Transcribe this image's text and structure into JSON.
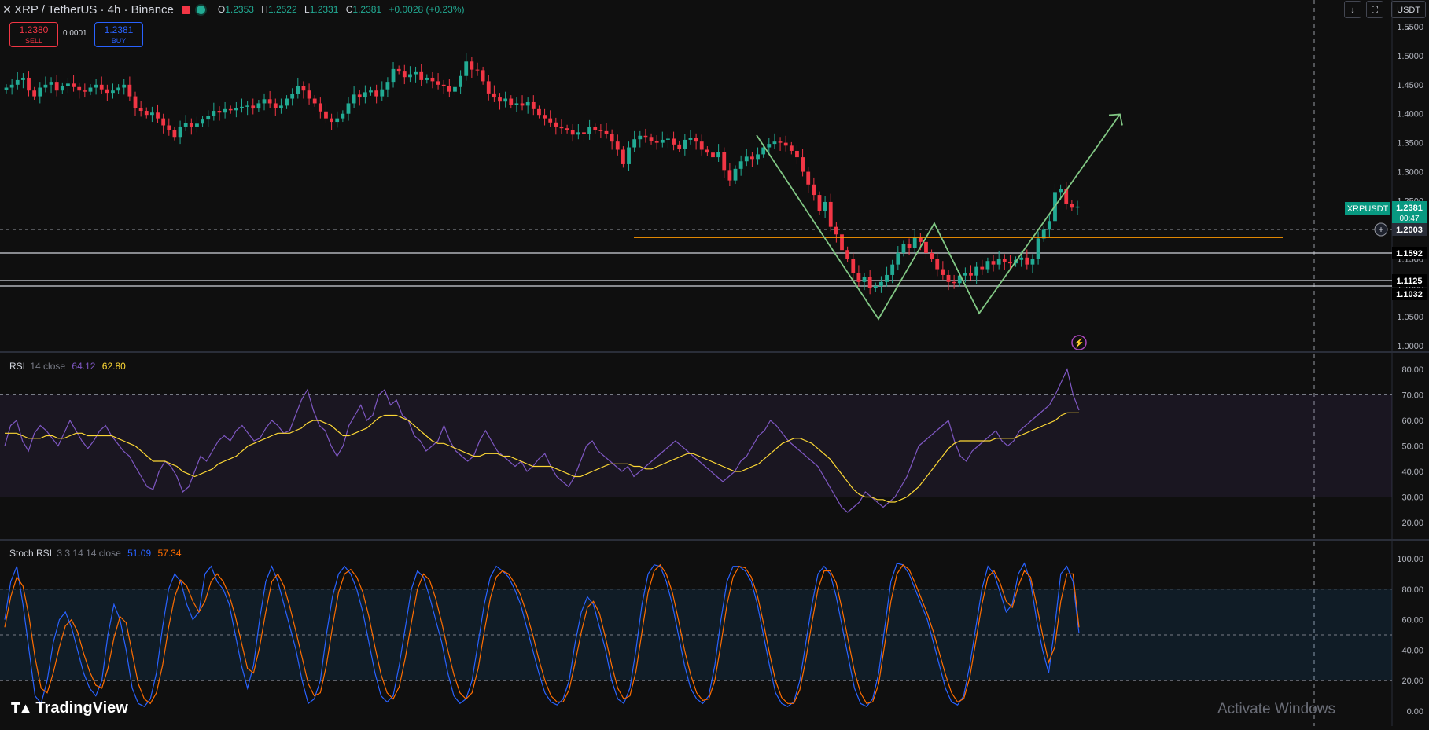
{
  "header": {
    "symbol": "XRP / TetherUS · 4h · Binance",
    "ohlc": {
      "o_label": "O",
      "o": "1.2353",
      "h_label": "H",
      "h": "1.2522",
      "l_label": "L",
      "l": "1.2331",
      "c_label": "C",
      "c": "1.2381",
      "change": "+0.0028 (+0.23%)"
    }
  },
  "trade": {
    "sell_price": "1.2380",
    "sell_label": "SELL",
    "spread": "0.0001",
    "buy_price": "1.2381",
    "buy_label": "BUY"
  },
  "controls": {
    "currency": "USDT"
  },
  "price_panel": {
    "axis_ticks": [
      "1.5500",
      "1.5000",
      "1.4500",
      "1.4000",
      "1.3500",
      "1.3000",
      "1.2500",
      "1.2000",
      "1.1500",
      "1.1000",
      "1.0500",
      "1.0000"
    ],
    "symbol_tag": "XRPUSDT",
    "last_price": "1.2381",
    "countdown": "00:47",
    "crosshair_price": "1.2003",
    "level_labels": [
      "1.1592",
      "1.1125",
      "1.1032"
    ]
  },
  "rsi_panel": {
    "name": "RSI",
    "params": "14 close",
    "value1": "64.12",
    "value2": "62.80",
    "axis_ticks": [
      "80.00",
      "70.00",
      "60.00",
      "50.00",
      "40.00",
      "30.00",
      "20.00"
    ]
  },
  "stoch_panel": {
    "name": "Stoch RSI",
    "params": "3 3 14 14 close",
    "value1": "51.09",
    "value2": "57.34",
    "axis_ticks": [
      "100.00",
      "80.00",
      "60.00",
      "40.00",
      "20.00",
      "0.00"
    ]
  },
  "branding": {
    "logo": "TradingView",
    "watermark": "Activate Windows"
  },
  "colors": {
    "up": "#22ab94",
    "down": "#f23645",
    "rsi": "#7e57c2",
    "rsi_ma": "#fdd835",
    "k": "#2962ff",
    "d": "#ff6d00",
    "pattern": "#81c784",
    "support": "#ff9800"
  },
  "chart_data": [
    {
      "type": "candlestick",
      "title": "XRP / TetherUS · 4h · Binance",
      "ylim": [
        0.985,
        1.56
      ],
      "series": [
        {
          "name": "XRPUSDT",
          "close": [
            1.445,
            1.45,
            1.458,
            1.462,
            1.44,
            1.43,
            1.445,
            1.45,
            1.455,
            1.44,
            1.448,
            1.452,
            1.446,
            1.44,
            1.438,
            1.445,
            1.45,
            1.442,
            1.436,
            1.44,
            1.445,
            1.45,
            1.43,
            1.41,
            1.405,
            1.398,
            1.402,
            1.392,
            1.38,
            1.372,
            1.36,
            1.378,
            1.384,
            1.378,
            1.383,
            1.39,
            1.396,
            1.405,
            1.402,
            1.408,
            1.406,
            1.41,
            1.412,
            1.414,
            1.409,
            1.418,
            1.425,
            1.418,
            1.41,
            1.414,
            1.426,
            1.434,
            1.448,
            1.44,
            1.426,
            1.418,
            1.404,
            1.392,
            1.386,
            1.392,
            1.4,
            1.418,
            1.433,
            1.428,
            1.437,
            1.44,
            1.43,
            1.442,
            1.455,
            1.477,
            1.474,
            1.463,
            1.468,
            1.473,
            1.458,
            1.462,
            1.456,
            1.45,
            1.448,
            1.438,
            1.446,
            1.465,
            1.49,
            1.476,
            1.475,
            1.456,
            1.435,
            1.428,
            1.421,
            1.426,
            1.415,
            1.418,
            1.414,
            1.42,
            1.408,
            1.398,
            1.392,
            1.385,
            1.378,
            1.375,
            1.372,
            1.364,
            1.368,
            1.365,
            1.377,
            1.372,
            1.37,
            1.365,
            1.352,
            1.338,
            1.313,
            1.342,
            1.356,
            1.362,
            1.36,
            1.353,
            1.35,
            1.355,
            1.357,
            1.347,
            1.34,
            1.355,
            1.358,
            1.352,
            1.338,
            1.333,
            1.325,
            1.334,
            1.303,
            1.285,
            1.305,
            1.318,
            1.326,
            1.322,
            1.33,
            1.342,
            1.348,
            1.352,
            1.35,
            1.345,
            1.336,
            1.325,
            1.3,
            1.278,
            1.26,
            1.232,
            1.248,
            1.205,
            1.192,
            1.165,
            1.15,
            1.125,
            1.11,
            1.118,
            1.099,
            1.103,
            1.11,
            1.122,
            1.14,
            1.16,
            1.175,
            1.168,
            1.186,
            1.179,
            1.16,
            1.15,
            1.132,
            1.122,
            1.11,
            1.108,
            1.121,
            1.125,
            1.121,
            1.136,
            1.132,
            1.146,
            1.14,
            1.15,
            1.145,
            1.142,
            1.148,
            1.152,
            1.14,
            1.15,
            1.185,
            1.2,
            1.215,
            1.265,
            1.27,
            1.245,
            1.238,
            1.24
          ]
        }
      ],
      "patterns": {
        "w_pattern": [
          [
            1.363,
            1.228
          ],
          [
            1.046,
            1.238
          ],
          [
            1.211,
            1.228
          ],
          [
            1.056,
            1.368
          ],
          [
            1.399,
            1.422
          ]
        ],
        "support_level": 1.187
      }
    },
    {
      "type": "line",
      "title": "RSI 14 close",
      "ylim": [
        15,
        83
      ],
      "bands": [
        70,
        50,
        30
      ],
      "series": [
        {
          "name": "RSI",
          "last": 64.12,
          "values": [
            50,
            58,
            60,
            52,
            48,
            55,
            58,
            56,
            53,
            50,
            55,
            60,
            56,
            52,
            49,
            52,
            56,
            58,
            54,
            51,
            48,
            46,
            42,
            38,
            34,
            33,
            40,
            44,
            42,
            38,
            32,
            34,
            40,
            46,
            44,
            48,
            52,
            54,
            52,
            56,
            58,
            55,
            52,
            53,
            57,
            60,
            58,
            55,
            56,
            62,
            68,
            72,
            64,
            58,
            56,
            50,
            46,
            50,
            58,
            62,
            66,
            60,
            62,
            70,
            72,
            66,
            68,
            62,
            60,
            54,
            52,
            48,
            50,
            52,
            58,
            52,
            48,
            46,
            44,
            46,
            52,
            56,
            52,
            48,
            46,
            44,
            42,
            44,
            40,
            42,
            45,
            47,
            42,
            38,
            36,
            34,
            38,
            44,
            50,
            52,
            48,
            46,
            44,
            42,
            40,
            42,
            38,
            40,
            42,
            44,
            46,
            48,
            50,
            52,
            50,
            48,
            46,
            44,
            42,
            40,
            38,
            36,
            38,
            40,
            44,
            46,
            50,
            54,
            56,
            60,
            58,
            55,
            52,
            50,
            48,
            46,
            44,
            42,
            38,
            34,
            30,
            26,
            24,
            26,
            28,
            32,
            30,
            28,
            26,
            28,
            30,
            34,
            38,
            44,
            50,
            52,
            54,
            56,
            58,
            60,
            52,
            46,
            44,
            48,
            50,
            52,
            54,
            56,
            52,
            50,
            52,
            56,
            58,
            60,
            62,
            64,
            66,
            70,
            75,
            80,
            70,
            64
          ]
        },
        {
          "name": "RSI-based MA",
          "last": 62.8,
          "values": [
            55,
            55,
            55,
            54,
            53,
            53,
            53,
            54,
            54,
            53,
            53,
            54,
            55,
            55,
            54,
            54,
            54,
            54,
            54,
            53,
            52,
            51,
            50,
            48,
            46,
            44,
            44,
            44,
            43,
            42,
            40,
            39,
            38,
            39,
            40,
            41,
            43,
            44,
            45,
            46,
            48,
            50,
            51,
            52,
            53,
            54,
            55,
            55,
            55,
            56,
            57,
            59,
            60,
            60,
            59,
            58,
            56,
            54,
            54,
            55,
            56,
            57,
            59,
            61,
            62,
            62,
            62,
            61,
            60,
            58,
            56,
            54,
            52,
            51,
            51,
            50,
            49,
            48,
            47,
            46,
            46,
            47,
            47,
            47,
            46,
            46,
            45,
            44,
            43,
            42,
            42,
            42,
            42,
            41,
            40,
            39,
            38,
            38,
            39,
            40,
            41,
            42,
            43,
            43,
            43,
            43,
            42,
            42,
            41,
            41,
            42,
            43,
            44,
            45,
            46,
            47,
            47,
            46,
            45,
            44,
            43,
            42,
            41,
            40,
            40,
            41,
            42,
            43,
            45,
            47,
            49,
            51,
            52,
            53,
            53,
            52,
            51,
            49,
            47,
            45,
            42,
            39,
            36,
            33,
            31,
            30,
            30,
            29,
            29,
            28,
            28,
            29,
            30,
            32,
            34,
            37,
            40,
            43,
            46,
            49,
            51,
            52,
            52,
            52,
            52,
            52,
            52,
            53,
            53,
            53,
            53,
            54,
            55,
            56,
            57,
            58,
            59,
            60,
            62,
            63,
            63,
            63
          ]
        }
      ]
    },
    {
      "type": "line",
      "title": "Stoch RSI 3 3 14 14 close",
      "ylim": [
        0,
        100
      ],
      "bands": [
        80,
        50,
        20
      ],
      "series": [
        {
          "name": "%K",
          "last": 51.09,
          "values": [
            60,
            85,
            95,
            70,
            40,
            10,
            5,
            20,
            45,
            60,
            65,
            55,
            40,
            25,
            15,
            10,
            20,
            50,
            70,
            60,
            40,
            15,
            5,
            3,
            8,
            25,
            55,
            80,
            90,
            85,
            70,
            60,
            65,
            90,
            95,
            85,
            80,
            70,
            50,
            30,
            15,
            30,
            60,
            85,
            95,
            85,
            70,
            55,
            40,
            20,
            5,
            8,
            20,
            50,
            75,
            90,
            95,
            90,
            80,
            65,
            45,
            25,
            10,
            6,
            10,
            30,
            55,
            80,
            92,
            88,
            75,
            60,
            45,
            25,
            10,
            5,
            8,
            20,
            45,
            70,
            88,
            95,
            92,
            88,
            80,
            70,
            55,
            40,
            25,
            12,
            6,
            4,
            8,
            20,
            45,
            65,
            75,
            70,
            55,
            40,
            20,
            8,
            5,
            15,
            40,
            70,
            90,
            96,
            95,
            85,
            70,
            50,
            30,
            15,
            8,
            5,
            10,
            30,
            60,
            85,
            95,
            95,
            92,
            85,
            70,
            50,
            30,
            12,
            5,
            3,
            6,
            20,
            45,
            70,
            90,
            95,
            90,
            75,
            55,
            35,
            15,
            5,
            3,
            8,
            25,
            55,
            85,
            97,
            96,
            90,
            80,
            70,
            60,
            45,
            30,
            15,
            6,
            4,
            10,
            30,
            55,
            80,
            95,
            90,
            78,
            65,
            70,
            90,
            97,
            85,
            60,
            40,
            25,
            55,
            90,
            95,
            85,
            51
          ]
        },
        {
          "name": "%D",
          "last": 57.34,
          "values": [
            55,
            75,
            88,
            82,
            62,
            35,
            15,
            12,
            25,
            42,
            56,
            60,
            52,
            38,
            26,
            17,
            15,
            28,
            48,
            62,
            58,
            38,
            18,
            8,
            5,
            12,
            30,
            55,
            75,
            86,
            82,
            72,
            65,
            72,
            85,
            90,
            85,
            76,
            62,
            45,
            28,
            25,
            42,
            65,
            85,
            90,
            82,
            68,
            52,
            35,
            18,
            10,
            12,
            30,
            55,
            78,
            90,
            93,
            88,
            78,
            62,
            42,
            24,
            12,
            8,
            16,
            35,
            58,
            80,
            90,
            86,
            74,
            58,
            40,
            24,
            12,
            8,
            12,
            28,
            52,
            74,
            88,
            92,
            90,
            84,
            76,
            64,
            50,
            34,
            20,
            10,
            6,
            6,
            14,
            32,
            52,
            68,
            72,
            64,
            48,
            30,
            15,
            8,
            10,
            26,
            52,
            78,
            92,
            96,
            90,
            78,
            60,
            40,
            24,
            12,
            7,
            8,
            20,
            44,
            70,
            88,
            95,
            94,
            88,
            76,
            58,
            38,
            20,
            9,
            5,
            5,
            14,
            34,
            58,
            80,
            92,
            92,
            84,
            66,
            46,
            26,
            12,
            5,
            6,
            18,
            44,
            72,
            90,
            96,
            93,
            84,
            74,
            64,
            52,
            38,
            24,
            12,
            6,
            8,
            22,
            46,
            70,
            88,
            92,
            84,
            72,
            68,
            82,
            92,
            88,
            70,
            50,
            32,
            42,
            72,
            90,
            90,
            55
          ]
        }
      ]
    }
  ]
}
